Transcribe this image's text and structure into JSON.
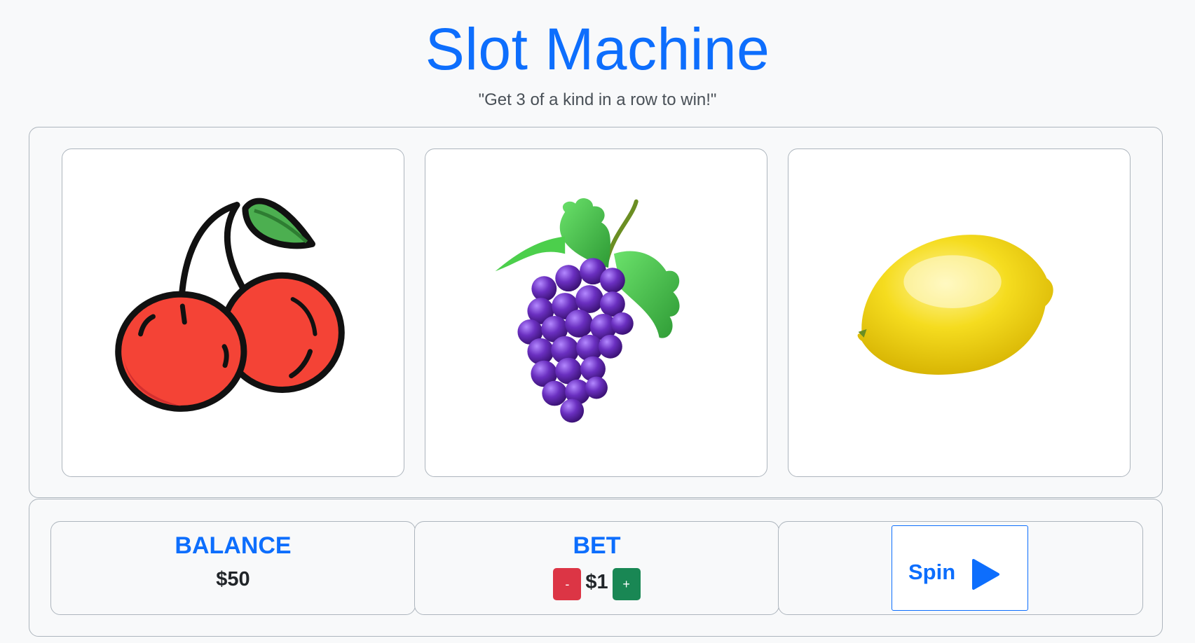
{
  "header": {
    "title": "Slot Machine",
    "subtitle": "\"Get 3 of a kind in a row to win!\""
  },
  "reels": [
    {
      "symbol": "cherry",
      "icon": "cherries-icon"
    },
    {
      "symbol": "grape",
      "icon": "grapes-icon"
    },
    {
      "symbol": "lemon",
      "icon": "lemon-icon"
    }
  ],
  "balance": {
    "label": "BALANCE",
    "value": "$50"
  },
  "bet": {
    "label": "BET",
    "decrease_label": "-",
    "value": "$1",
    "increase_label": "+"
  },
  "spin": {
    "label": "Spin",
    "icon": "play-icon"
  },
  "colors": {
    "accent": "#0d6efd",
    "danger": "#dc3545",
    "success": "#198754",
    "background": "#f8f9fa"
  }
}
